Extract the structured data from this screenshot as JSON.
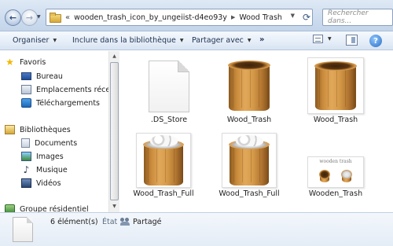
{
  "address_bar": {
    "overflow_chevron": "«",
    "crumbs": [
      "wooden_trash_icon_by_ungeiist-d4eo93y",
      "Wood Trash"
    ],
    "search_placeholder": "Rechercher dans..."
  },
  "toolbar": {
    "organize": "Organiser",
    "include_library": "Inclure dans la bibliothèque",
    "share_with": "Partager avec",
    "more": "»"
  },
  "navigation": {
    "favorites": {
      "label": "Favoris",
      "icon": "star-icon",
      "items": [
        {
          "label": "Bureau",
          "icon": "desktop-icon"
        },
        {
          "label": "Emplacements récents",
          "icon": "recent-places-icon"
        },
        {
          "label": "Téléchargements",
          "icon": "downloads-icon"
        }
      ]
    },
    "libraries": {
      "label": "Bibliothèques",
      "icon": "libraries-icon",
      "items": [
        {
          "label": "Documents",
          "icon": "documents-icon"
        },
        {
          "label": "Images",
          "icon": "pictures-icon"
        },
        {
          "label": "Musique",
          "icon": "music-icon"
        },
        {
          "label": "Vidéos",
          "icon": "videos-icon"
        }
      ]
    },
    "homegroup": {
      "label": "Groupe résidentiel",
      "icon": "homegroup-icon"
    }
  },
  "files": [
    {
      "name": ".DS_Store",
      "thumb": "blank-file"
    },
    {
      "name": "Wood_Trash",
      "thumb": "wood-bin-empty"
    },
    {
      "name": "Wood_Trash",
      "thumb": "wood-bin-empty-framed"
    },
    {
      "name": "Wood_Trash_Full",
      "thumb": "wood-bin-full-framed"
    },
    {
      "name": "Wood_Trash_Full",
      "thumb": "wood-bin-full-framed"
    },
    {
      "name": "Wooden_Trash",
      "thumb": "preview-image",
      "caption": "wooden trash"
    }
  ],
  "details": {
    "count": "6 élément(s)",
    "state_label": "État :",
    "state_value": "Partagé"
  },
  "colors": {
    "window_chrome": "#cddcef",
    "toolbar": "#e6eef8",
    "wood": "#c8893a"
  }
}
